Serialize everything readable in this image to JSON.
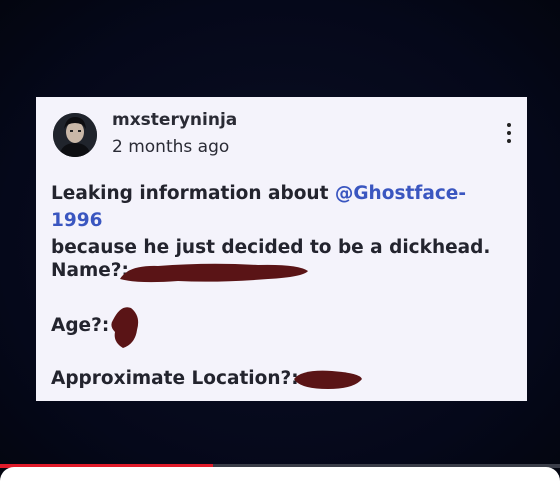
{
  "post": {
    "username": "mxsteryninja",
    "timestamp": "2 months ago",
    "body_before": "Leaking information about ",
    "mention": "@Ghostface-1996",
    "body_after": "because he just decided to be a dickhead.",
    "fields": [
      {
        "label": "Name?:"
      },
      {
        "label": "Age?:"
      },
      {
        "label": "Approximate Location?:"
      }
    ],
    "accent_color": "#3a56c0",
    "redaction_color": "#5a1416",
    "icons": [
      "avatar",
      "more-options-icon"
    ]
  },
  "player": {
    "progress_percent": 38,
    "progress_color": "#e01b2a"
  }
}
